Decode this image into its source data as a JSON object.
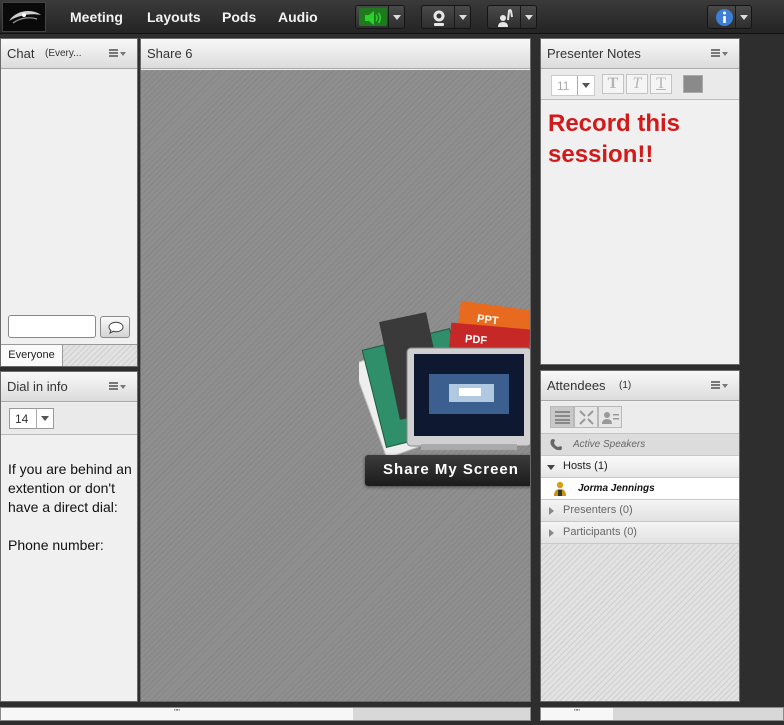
{
  "menubar": {
    "items": [
      "Meeting",
      "Layouts",
      "Pods",
      "Audio"
    ],
    "icons": [
      "speaker-icon",
      "webcam-icon",
      "raise-hand-icon",
      "info-icon"
    ],
    "speaker_active_color": "#2bd12b"
  },
  "chat": {
    "title": "Chat",
    "scope": "(Every...",
    "tab_everyone": "Everyone"
  },
  "dialin": {
    "title": "Dial in info",
    "font_size": "14",
    "line1": "If you are behind an extention or don't have a direct dial:",
    "line2": "Phone number:"
  },
  "share": {
    "title": "Share 6",
    "button": "Share My Screen",
    "doc_labels": [
      "PPT",
      "PDF"
    ]
  },
  "notes": {
    "title": "Presenter Notes",
    "font_size": "11",
    "format_buttons": [
      "T",
      "T",
      "T"
    ],
    "text": "Record this session!!",
    "text_color": "#d11a1a"
  },
  "attendees": {
    "title": "Attendees",
    "count": "(1)",
    "active_speakers": "Active Speakers",
    "hosts": "Hosts (1)",
    "host_name": "Jorma Jennings",
    "presenters": "Presenters (0)",
    "participants": "Participants (0)"
  },
  "scrollbars": {
    "grip": "\"\""
  }
}
